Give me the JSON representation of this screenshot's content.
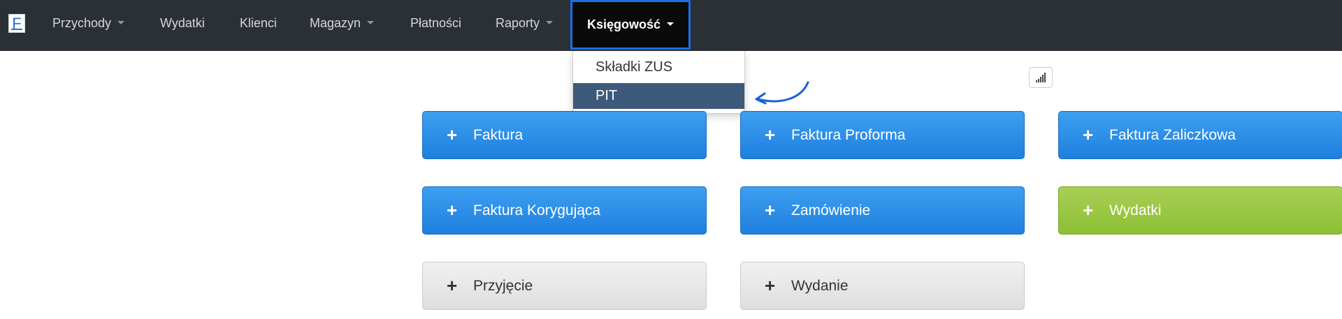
{
  "navbar": {
    "logo_letter": "F",
    "items": [
      {
        "label": "Przychody",
        "has_caret": true
      },
      {
        "label": "Wydatki",
        "has_caret": false
      },
      {
        "label": "Klienci",
        "has_caret": false
      },
      {
        "label": "Magazyn",
        "has_caret": true
      },
      {
        "label": "Płatności",
        "has_caret": false
      },
      {
        "label": "Raporty",
        "has_caret": true
      },
      {
        "label": "Księgowość",
        "has_caret": true,
        "active": true
      }
    ]
  },
  "dropdown": {
    "items": [
      {
        "label": "Składki ZUS",
        "highlighted": false
      },
      {
        "label": "PIT",
        "highlighted": true
      }
    ]
  },
  "buttons": [
    {
      "label": "Faktura",
      "style": "blue"
    },
    {
      "label": "Faktura Proforma",
      "style": "blue"
    },
    {
      "label": "Faktura Zaliczkowa",
      "style": "blue"
    },
    {
      "label": "Faktura Korygująca",
      "style": "blue"
    },
    {
      "label": "Zamówienie",
      "style": "blue"
    },
    {
      "label": "Wydatki",
      "style": "green"
    },
    {
      "label": "Przyjęcie",
      "style": "gray"
    },
    {
      "label": "Wydanie",
      "style": "gray"
    }
  ],
  "icons": {
    "plus": "+",
    "stats": "signal-bars-icon",
    "annotation_arrow": "curved-arrow-icon"
  },
  "colors": {
    "navbar_bg": "#2b3035",
    "active_border": "#1a6ee6",
    "highlight_bg": "#3e5a7a",
    "button_blue": "#2a8ce6",
    "button_green": "#9bc741",
    "button_gray": "#e6e6e6"
  }
}
